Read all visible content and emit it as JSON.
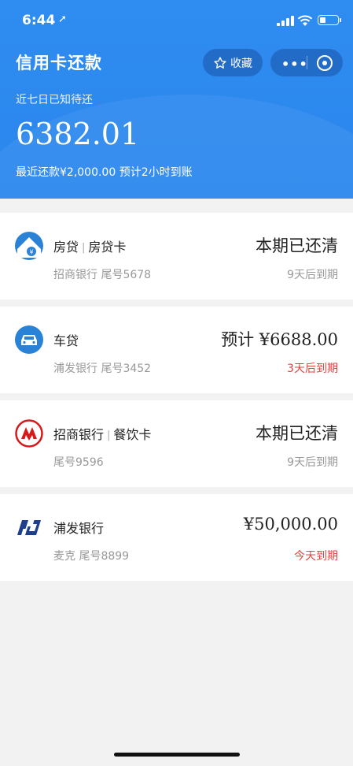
{
  "status_bar": {
    "time": "6:44",
    "location_glyph": "➚"
  },
  "header": {
    "title": "信用卡还款",
    "favorite_label": "收藏",
    "more_label": "•••",
    "subtitle": "近七日已知待还",
    "amount": "6382.01",
    "recent": "最近还款¥2,000.00 预计2小时到账",
    "colors": {
      "background": "#2f8cf0",
      "text": "#ffffff"
    }
  },
  "loans": [
    {
      "icon": "house-loan-icon",
      "name": "房贷",
      "type": "房贷卡",
      "meta": "招商银行 尾号5678",
      "right_text": "本期已还清",
      "due_text": "9天后到期",
      "due_status": "normal"
    },
    {
      "icon": "car-loan-icon",
      "name": "车贷",
      "type": "",
      "meta": "浦发银行 尾号3452",
      "right_text": "预计 ¥6688.00",
      "due_text": "3天后到期",
      "due_status": "warning"
    },
    {
      "icon": "cmb-bank-icon",
      "name": "招商银行",
      "type": "餐饮卡",
      "meta": "尾号9596",
      "right_text": "本期已还清",
      "due_text": "9天后到期",
      "due_status": "normal"
    },
    {
      "icon": "spdb-bank-icon",
      "name": "浦发银行",
      "type": "",
      "meta": "麦克 尾号8899",
      "right_text": "¥50,000.00",
      "due_text": "今天到期",
      "due_status": "warning"
    }
  ],
  "theme": {
    "accent": "#2f8cf0",
    "warning": "#e64340",
    "muted": "#999999",
    "page_bg": "#f2f2f2"
  }
}
